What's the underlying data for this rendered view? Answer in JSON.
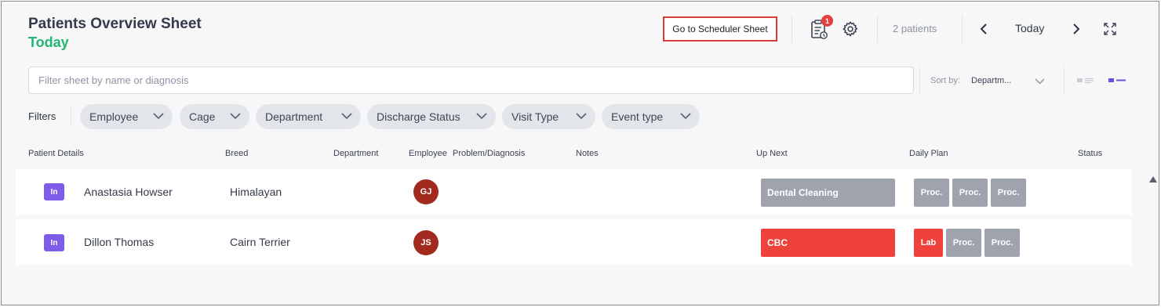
{
  "header": {
    "title": "Patients Overview Sheet",
    "subtitle": "Today",
    "scheduler_button": "Go to Scheduler Sheet",
    "tasks_badge": "1",
    "patient_count": "2 patients",
    "date_label": "Today"
  },
  "search": {
    "placeholder": "Filter sheet by name or diagnosis"
  },
  "sort": {
    "label": "Sort by:",
    "value": "Departm..."
  },
  "filters": {
    "label": "Filters",
    "chips": [
      "Employee",
      "Cage",
      "Department",
      "Discharge Status",
      "Visit Type",
      "Event type"
    ]
  },
  "columns": [
    "Patient Details",
    "Breed",
    "Department",
    "Employee",
    "Problem/Diagnosis",
    "Notes",
    "Up Next",
    "Daily Plan",
    "Status"
  ],
  "patients": [
    {
      "status_badge": "In",
      "name": "Anastasia Howser",
      "breed": "Himalayan",
      "employee_initials": "GJ",
      "up_next": "Dental Cleaning",
      "up_next_color": "#9ea3ae",
      "plan": [
        {
          "label": "Proc.",
          "color": "#9ea3ae"
        },
        {
          "label": "Proc.",
          "color": "#9ea3ae"
        },
        {
          "label": "Proc.",
          "color": "#9ea3ae"
        }
      ]
    },
    {
      "status_badge": "In",
      "name": "Dillon Thomas",
      "breed": "Cairn Terrier",
      "employee_initials": "JS",
      "up_next": "CBC",
      "up_next_color": "#ef423c",
      "plan": [
        {
          "label": "Lab",
          "color": "#ef423c"
        },
        {
          "label": "Proc.",
          "color": "#9ea3ae"
        },
        {
          "label": "Proc.",
          "color": "#9ea3ae"
        }
      ]
    }
  ],
  "colors": {
    "accent_green": "#22b573",
    "in_badge": "#7c5ce8",
    "avatar": "#a12b1f",
    "alert_red": "#ef423c",
    "neutral_block": "#9ea3ae"
  },
  "icons": [
    "tasks-clipboard-icon",
    "settings-gear-icon",
    "chevron-left-icon",
    "chevron-right-icon",
    "expand-icon",
    "list-view-icon",
    "compact-view-icon",
    "chevron-down-icon",
    "scroll-up-icon"
  ]
}
